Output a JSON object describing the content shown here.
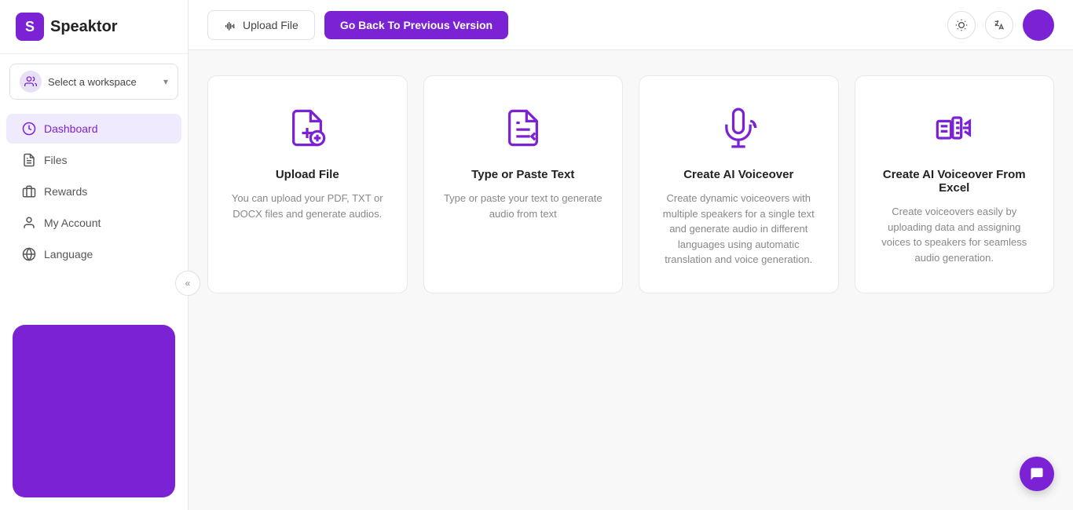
{
  "brand": {
    "logo_letter": "S",
    "name": "Speaktor"
  },
  "sidebar": {
    "workspace_label": "Select a workspace",
    "nav_items": [
      {
        "id": "dashboard",
        "label": "Dashboard",
        "active": true
      },
      {
        "id": "files",
        "label": "Files",
        "active": false
      },
      {
        "id": "rewards",
        "label": "Rewards",
        "active": false
      },
      {
        "id": "my-account",
        "label": "My Account",
        "active": false
      },
      {
        "id": "language",
        "label": "Language",
        "active": false
      }
    ],
    "collapse_label": "«"
  },
  "topbar": {
    "upload_label": "Upload File",
    "prev_version_label": "Go Back To Previous Version"
  },
  "cards": [
    {
      "id": "upload-file",
      "title": "Upload File",
      "description": "You can upload your PDF, TXT or DOCX files and generate audios."
    },
    {
      "id": "type-paste",
      "title": "Type or Paste Text",
      "description": "Type or paste your text to generate audio from text"
    },
    {
      "id": "ai-voiceover",
      "title": "Create AI Voiceover",
      "description": "Create dynamic voiceovers with multiple speakers for a single text and generate audio in different languages using automatic translation and voice generation."
    },
    {
      "id": "ai-voiceover-excel",
      "title": "Create AI Voiceover From Excel",
      "description": "Create voiceovers easily by uploading data and assigning voices to speakers for seamless audio generation."
    }
  ],
  "colors": {
    "purple": "#7b22d4",
    "purple_light": "#f0eaff"
  }
}
